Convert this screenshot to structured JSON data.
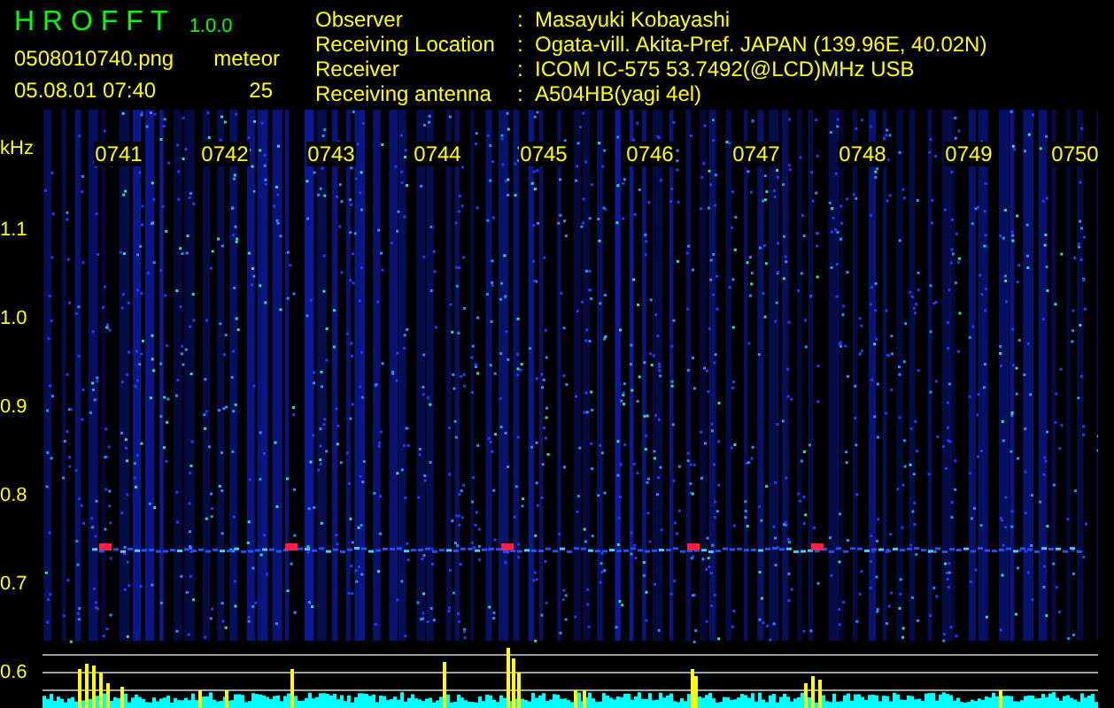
{
  "app": {
    "title": "H R O F F T",
    "version": "1.0.0",
    "file": "0508010740.png",
    "date_time": "05.08.01 07:40",
    "counter": {
      "label": "meteor",
      "value": "25"
    }
  },
  "info": [
    {
      "label": "Observer",
      "separator": ":",
      "value": "Masayuki Kobayashi"
    },
    {
      "label": "Receiving Location",
      "separator": ":",
      "value": "Ogata-vill. Akita-Pref. JAPAN (139.96E, 40.02N)"
    },
    {
      "label": "Receiver",
      "separator": ":",
      "value": "ICOM IC-575 53.7492(@LCD)MHz USB"
    },
    {
      "label": "Receiving antenna",
      "separator": ":",
      "value": "A504HB(yagi 4el)"
    }
  ],
  "plot": {
    "y_unit": "kHz",
    "y_labels": [
      "1.1",
      "1.0",
      "0.9",
      "0.8",
      "0.7",
      "0.6"
    ],
    "time_labels": [
      "0741",
      "0742",
      "0743",
      "0744",
      "0745",
      "0746",
      "0747",
      "0748",
      "0749",
      "0750"
    ]
  }
}
